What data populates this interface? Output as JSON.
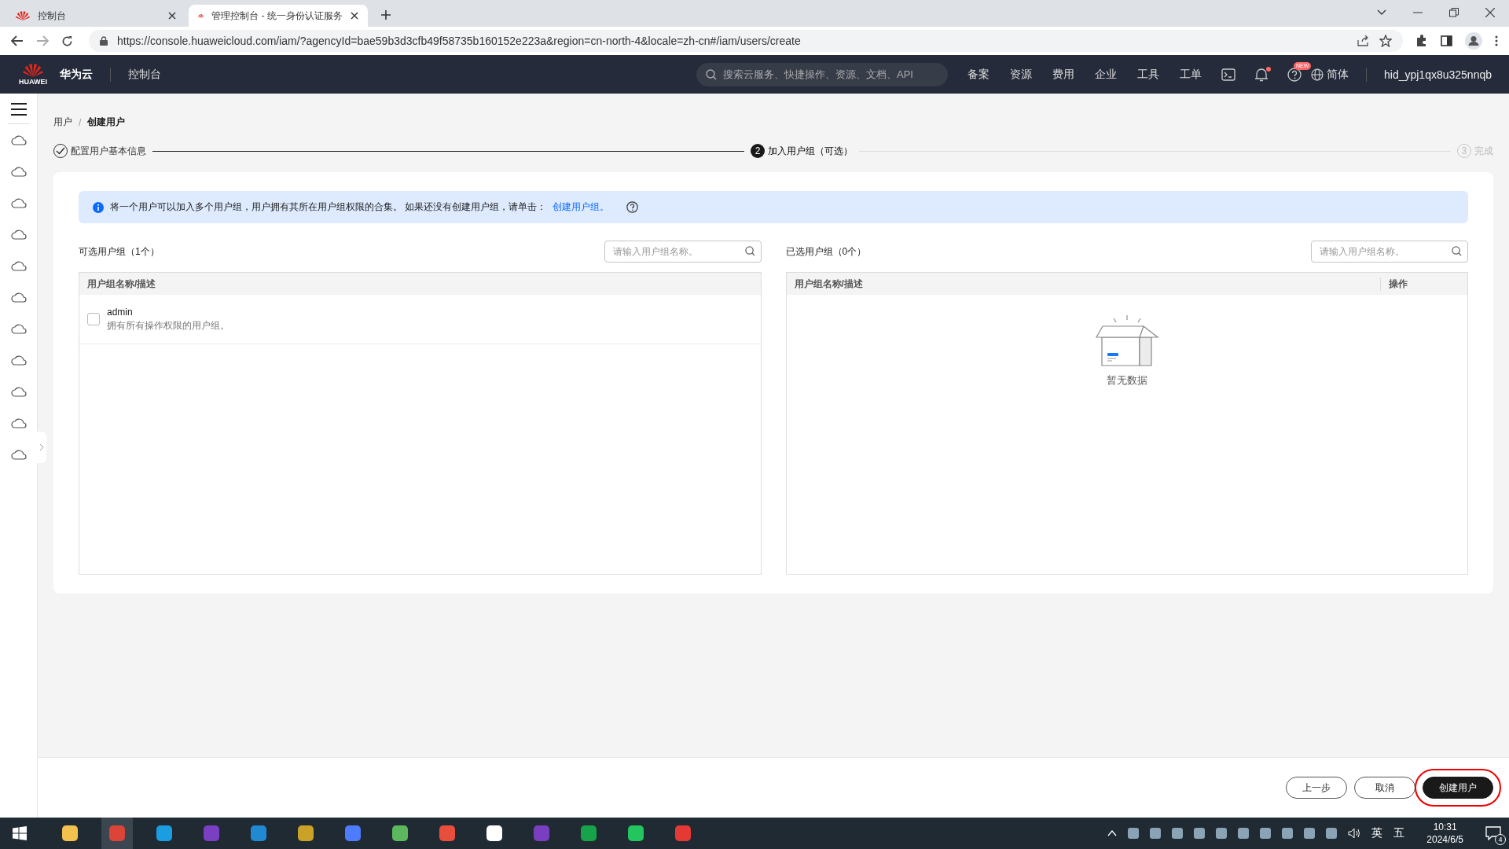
{
  "browser": {
    "tabs": [
      {
        "title": "控制台",
        "selected": false
      },
      {
        "title": "管理控制台 - 统一身份认证服务",
        "selected": true
      }
    ],
    "url": "https://console.huaweicloud.com/iam/?agencyId=bae59b3d3cfb49f58735b160152e223a&region=cn-north-4&locale=zh-cn#/iam/users/create"
  },
  "header": {
    "brand": "华为云",
    "logo_text": "HUAWEI",
    "console": "控制台",
    "search_placeholder": "搜索云服务、快捷操作、资源、文档、API",
    "nav": [
      "备案",
      "资源",
      "费用",
      "企业",
      "工具",
      "工单"
    ],
    "new_badge": "NEW",
    "language": "简体",
    "user": "hid_ypj1qx8u325nnqb"
  },
  "breadcrumb": {
    "parent": "用户",
    "separator": "/",
    "current": "创建用户"
  },
  "steps": [
    {
      "label": "配置用户基本信息",
      "completed": true,
      "selected": false
    },
    {
      "label": "加入用户组（可选）",
      "number": "2",
      "completed": false,
      "selected": true
    },
    {
      "label": "完成",
      "number": "3",
      "completed": false,
      "selected": false
    }
  ],
  "info": {
    "text": "将一个用户可以加入多个用户组，用户拥有其所在用户组权限的合集。 如果还没有创建用户组，请单击：",
    "link": "创建用户组。"
  },
  "available": {
    "title": "可选用户组（1个）",
    "search_placeholder": "请输入用户组名称。",
    "column": "用户组名称/描述",
    "rows": [
      {
        "name": "admin",
        "description": "拥有所有操作权限的用户组。",
        "checked": false
      }
    ]
  },
  "chosen": {
    "title": "已选用户组（0个）",
    "search_placeholder": "请输入用户组名称。",
    "columns": [
      "用户组名称/描述",
      "操作"
    ],
    "empty": "暂无数据"
  },
  "footer": {
    "buttons": [
      {
        "label": "上一步",
        "kind": "secondary",
        "highlighted": false
      },
      {
        "label": "取消",
        "kind": "secondary",
        "highlighted": false
      },
      {
        "label": "创建用户",
        "kind": "primary",
        "highlighted": true
      }
    ]
  },
  "taskbar": {
    "ime": "英",
    "ime_mode": "五",
    "time": "10:31",
    "date": "2024/6/5",
    "notifications": "4"
  }
}
